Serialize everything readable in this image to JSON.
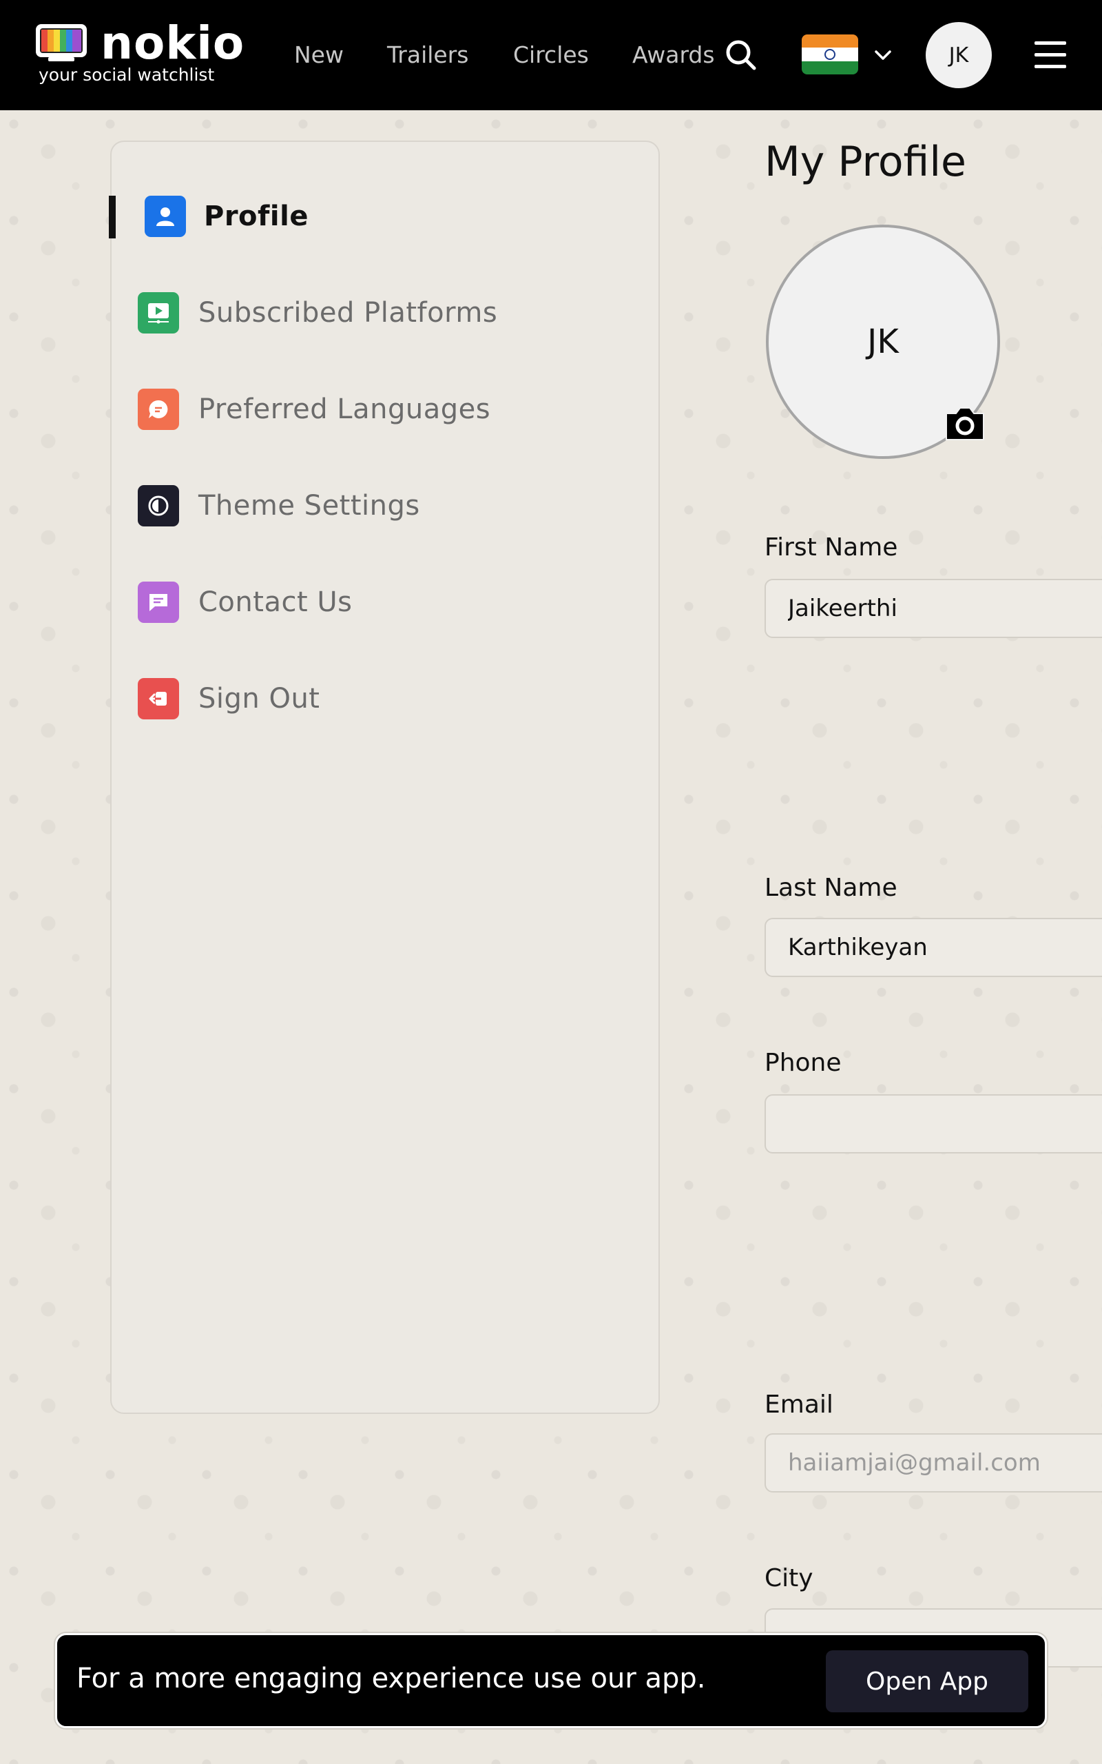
{
  "header": {
    "logo_name": "nokio",
    "logo_tagline": "your social watchlist",
    "nav": [
      {
        "label": "New"
      },
      {
        "label": "Trailers"
      },
      {
        "label": "Circles"
      },
      {
        "label": "Awards"
      }
    ],
    "avatar_initials": "JK",
    "icons": [
      "search-icon",
      "india-flag-icon",
      "chevron-down-icon",
      "menu-icon"
    ]
  },
  "sidebar": {
    "items": [
      {
        "label": "Profile",
        "icon": "user-icon",
        "color": "#1a73e8",
        "active": true
      },
      {
        "label": "Subscribed Platforms",
        "icon": "play-screen-icon",
        "color": "#2ea863"
      },
      {
        "label": "Preferred Languages",
        "icon": "chat-bubble-icon",
        "color": "#f2704f"
      },
      {
        "label": "Theme Settings",
        "icon": "contrast-icon",
        "color": "#1d1d2b"
      },
      {
        "label": "Contact Us",
        "icon": "message-icon",
        "color": "#b66ad9"
      },
      {
        "label": "Sign Out",
        "icon": "sign-out-icon",
        "color": "#e8504f"
      }
    ]
  },
  "profile": {
    "title": "My Profile",
    "avatar_initials": "JK",
    "fields": {
      "first_name": {
        "label": "First Name",
        "value": "Jaikeerthi"
      },
      "last_name": {
        "label": "Last Name",
        "value": "Karthikeyan"
      },
      "phone": {
        "label": "Phone",
        "value": ""
      },
      "email": {
        "label": "Email",
        "placeholder": "haiiamjai@gmail.com"
      },
      "city": {
        "label": "City",
        "value": ""
      }
    }
  },
  "banner": {
    "text": "For a more engaging experience use our app.",
    "button": "Open App"
  },
  "colors": {
    "background": "#ebe7df",
    "header": "#000000",
    "accent_dark": "#1c1c2a"
  }
}
